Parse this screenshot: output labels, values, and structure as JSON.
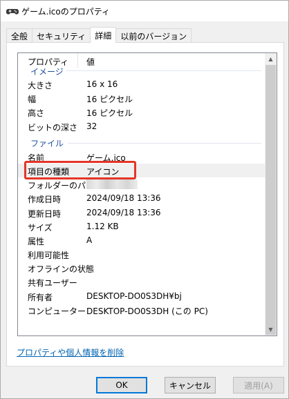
{
  "window": {
    "title": "ゲーム.icoのプロパティ"
  },
  "tabs": [
    {
      "label": "全般"
    },
    {
      "label": "セキュリティ"
    },
    {
      "label": "詳細"
    },
    {
      "label": "以前のバージョン"
    }
  ],
  "details": {
    "header": {
      "property": "プロパティ",
      "value": "値"
    },
    "groups": [
      {
        "label": "イメージ",
        "rows": [
          {
            "key": "大きさ",
            "value": "16 x 16"
          },
          {
            "key": "幅",
            "value": "16 ピクセル"
          },
          {
            "key": "高さ",
            "value": "16 ピクセル"
          },
          {
            "key": "ビットの深さ",
            "value": "32"
          }
        ]
      },
      {
        "label": "ファイル",
        "rows": [
          {
            "key": "名前",
            "value": "ゲーム.ico"
          },
          {
            "key": "項目の種類",
            "value": "アイコン"
          },
          {
            "key": "フォルダーのパス",
            "value": ""
          },
          {
            "key": "作成日時",
            "value": "2024/09/18 13:36"
          },
          {
            "key": "更新日時",
            "value": "2024/09/18 13:36"
          },
          {
            "key": "サイズ",
            "value": "1.12 KB"
          },
          {
            "key": "属性",
            "value": "A"
          },
          {
            "key": "利用可能性",
            "value": ""
          },
          {
            "key": "オフラインの状態",
            "value": ""
          },
          {
            "key": "共有ユーザー",
            "value": ""
          },
          {
            "key": "所有者",
            "value": "DESKTOP-DO0S3DH¥bj"
          },
          {
            "key": "コンピューター",
            "value": "DESKTOP-DO0S3DH (この PC)"
          }
        ]
      }
    ]
  },
  "remove_link": "プロパティや個人情報を削除",
  "buttons": {
    "ok": "OK",
    "cancel": "キャンセル",
    "apply": "適用(A)"
  },
  "colors": {
    "highlight": "#e53526",
    "group_text": "#1e4e9e",
    "link": "#0063b1"
  }
}
